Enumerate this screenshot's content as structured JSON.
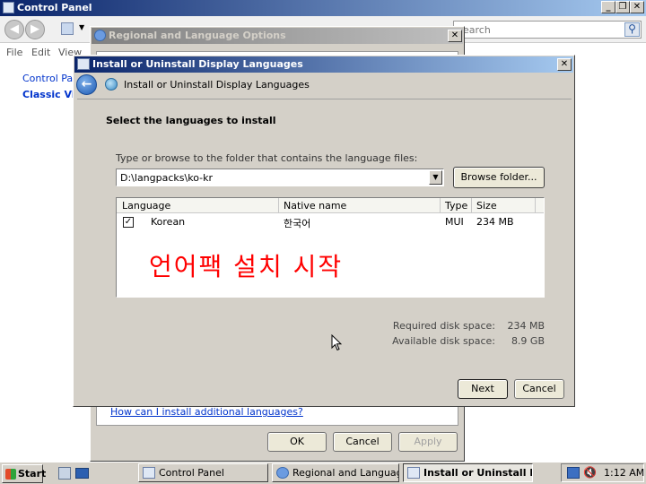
{
  "control_panel": {
    "title": "Control Panel",
    "menu": [
      "File",
      "Edit",
      "View"
    ],
    "search_placeholder": "Search",
    "nav_home": "Control Panel",
    "nav_classic": "Classic View"
  },
  "regional": {
    "title": "Regional and Language Options",
    "help_link": "How can I install additional languages?",
    "ok_label": "OK",
    "cancel_label": "Cancel",
    "apply_label": "Apply"
  },
  "dialog": {
    "title": "Install or Uninstall Display Languages",
    "header": "Install or Uninstall Display Languages",
    "heading": "Select the languages to install",
    "folder_label": "Type or browse to the folder that contains the language files:",
    "folder_value": "D:\\langpacks\\ko-kr",
    "browse_label": "Browse folder...",
    "columns": [
      "Language",
      "Native name",
      "Type",
      "Size"
    ],
    "rows": [
      {
        "language": "Korean",
        "native": "한국어",
        "type": "MUI",
        "size": "234 MB",
        "checked": true
      }
    ],
    "annotation": "언어팩 설치 시작",
    "required_label": "Required disk space:",
    "required_value": "234 MB",
    "available_label": "Available disk space:",
    "available_value": "8.9 GB",
    "next_label": "Next",
    "cancel_label": "Cancel"
  },
  "taskbar": {
    "start_label": "Start",
    "tasks": [
      {
        "label": "Control Panel",
        "active": false
      },
      {
        "label": "Regional and Language ...",
        "active": false
      },
      {
        "label": "Install or Uninstall Dis...",
        "active": true
      }
    ],
    "clock": "1:12 AM"
  },
  "colors": {
    "annotation": "#ff0000",
    "link": "#0033cc",
    "titlebar_active": "#0a246a"
  }
}
